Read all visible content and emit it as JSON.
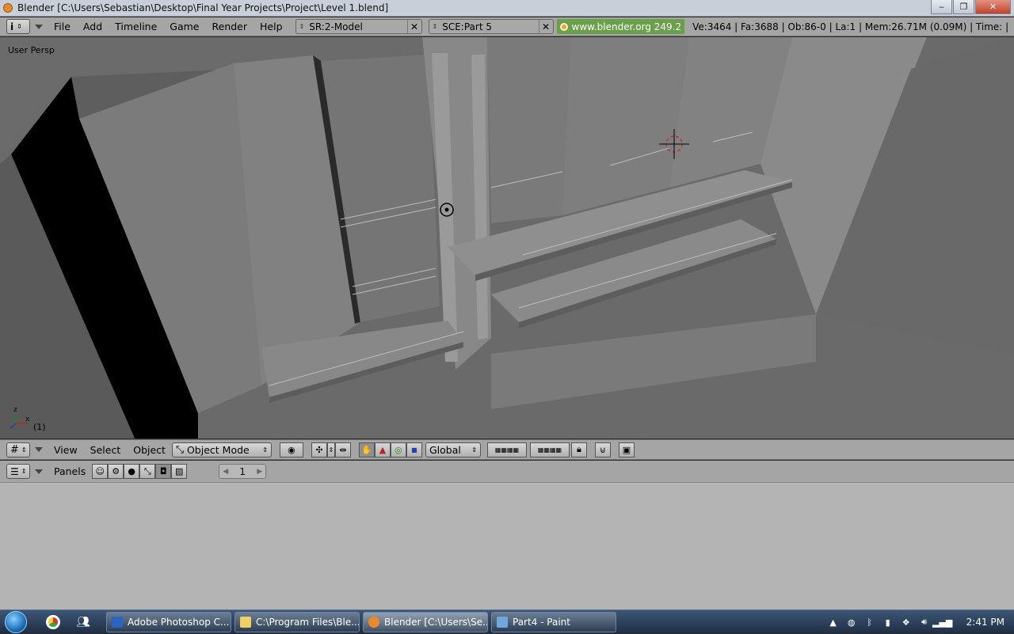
{
  "window": {
    "title": "Blender [C:\\Users\\Sebastian\\Desktop\\Final Year Projects\\Project\\Level 1.blend]",
    "controls": {
      "minimize": "‒",
      "maximize": "❐",
      "close": "✕"
    }
  },
  "topbar": {
    "menus": [
      "File",
      "Add",
      "Timeline",
      "Game",
      "Render",
      "Help"
    ],
    "screen_field": "SR:2-Model",
    "scene_field": "SCE:Part 5",
    "clear_symbol": "✕",
    "link_text": "www.blender.org 249.2",
    "stats": "Ve:3464 | Fa:3688 | Ob:86-0 | La:1  | Mem:26.71M (0.09M)  | Time: |"
  },
  "viewport": {
    "label": "User Persp",
    "frame": "(1)",
    "axis": {
      "x": "x",
      "z": "z"
    },
    "colors": {
      "floor": "#6a6a6a",
      "wall": "#7d7d7d",
      "shadow": "#000000",
      "cursor": "#cc2222"
    }
  },
  "header3d": {
    "menus": [
      "View",
      "Select",
      "Object"
    ],
    "mode": "Object Mode",
    "orientation": "Global"
  },
  "buttons_header": {
    "label": "Panels",
    "page": "1"
  },
  "taskbar": {
    "tasks": [
      {
        "label": "Adobe Photoshop C...",
        "icon_color": "#2a66c0"
      },
      {
        "label": "C:\\Program Files\\Ble...",
        "icon_color": "#f0d060"
      },
      {
        "label": "Blender [C:\\Users\\Se...",
        "icon_color": "#e8892b"
      },
      {
        "label": "Part4 - Paint",
        "icon_color": "#6fa8dc"
      }
    ],
    "time": "2:41 PM"
  }
}
